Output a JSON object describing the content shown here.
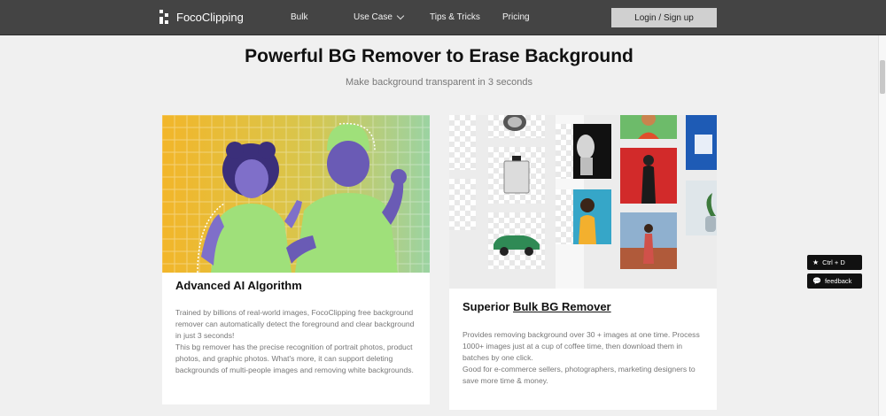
{
  "header": {
    "brand": "FocoClipping",
    "nav": {
      "bulk": "Bulk",
      "use_case": "Use Case",
      "tips": "Tips & Tricks",
      "pricing": "Pricing"
    },
    "login_label": "Login / Sign up"
  },
  "hero": {
    "title": "Powerful BG Remover to Erase Background",
    "subtitle": "Make background transparent in 3 seconds"
  },
  "cards": [
    {
      "title": "Advanced AI Algorithm",
      "body": [
        "Trained by billions of real-world images, FocoClipping free background remover can automatically detect the foreground and clear background in just 3 seconds!",
        "This bg remover has the precise recognition of portrait photos, product photos, and graphic photos. What's more, it can support deleting backgrounds of multi-people images and removing white backgrounds."
      ]
    },
    {
      "title_prefix": "Superior ",
      "title_link": "Bulk BG Remover",
      "body": [
        "Provides removing background over 30 + images at one time. Process 1000+ images just at a cup of coffee time, then download them in batches by one click.",
        "Good for e-commerce sellers, photographers, marketing designers to save more time & money."
      ]
    }
  ],
  "floating": {
    "ctrl_label": "Ctrl + D",
    "feedback_label": "feedback",
    "ctrl_icon": "star-icon",
    "feedback_icon": "chat-bubble-icon"
  },
  "colors": {
    "header_bg": "#444444",
    "page_bg": "#f0f0f0",
    "login_bg": "#d0d0d0",
    "hero_yellow": "#f2b62a",
    "hero_green": "#9bd3a2",
    "duotone_purple": "#6a5bb5",
    "duotone_lime": "#9fe07a"
  }
}
